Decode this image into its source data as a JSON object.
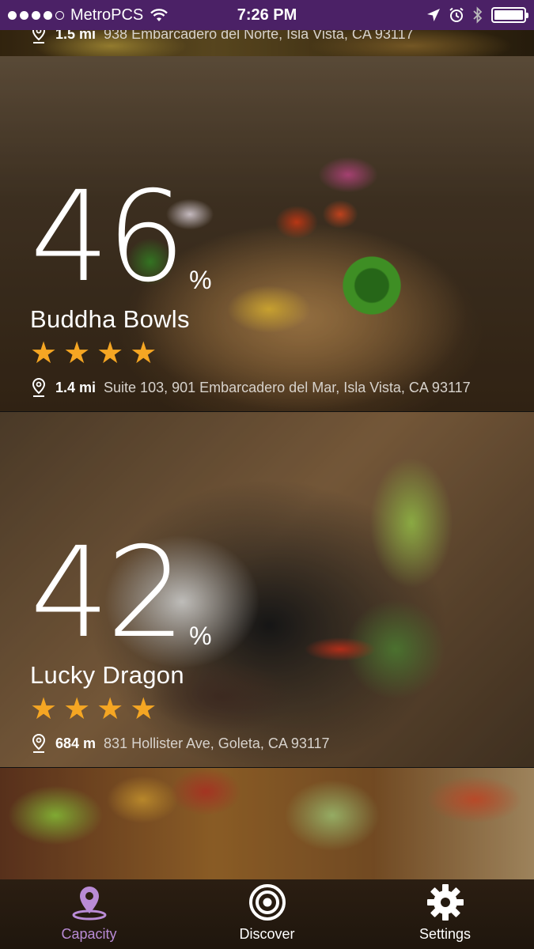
{
  "status_bar": {
    "carrier": "MetroPCS",
    "time": "7:26 PM",
    "signal_bars_filled": 4,
    "signal_bars_total": 5
  },
  "cards": [
    {
      "distance": "1.5 mi",
      "address": "938 Embarcadero del Norte, Isla Vista, CA 93117"
    },
    {
      "percent": "46",
      "percent_sign": "%",
      "name": "Buddha Bowls",
      "stars": 4,
      "distance": "1.4 mi",
      "address": "Suite 103, 901 Embarcadero del Mar, Isla Vista, CA 93117"
    },
    {
      "percent": "42",
      "percent_sign": "%",
      "name": "Lucky Dragon",
      "stars": 4,
      "distance": "684 m",
      "address": "831 Hollister Ave, Goleta, CA 93117"
    }
  ],
  "tabs": [
    {
      "label": "Capacity",
      "icon": "map-pin-icon",
      "active": true
    },
    {
      "label": "Discover",
      "icon": "target-icon",
      "active": false
    },
    {
      "label": "Settings",
      "icon": "gear-icon",
      "active": false
    }
  ],
  "colors": {
    "status_bar": "#4b2166",
    "star": "#f5a623",
    "active_tab": "#b98bd6"
  }
}
